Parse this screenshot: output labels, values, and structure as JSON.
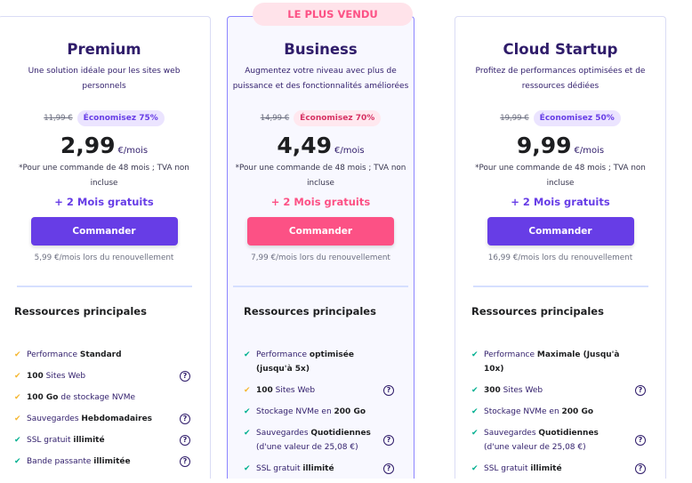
{
  "badge": "LE PLUS VENDU",
  "colors": {
    "purple": "#673de6",
    "pink": "#fc5185",
    "check_green": "#00b090",
    "check_yellow": "#f5b731"
  },
  "plans": [
    {
      "title": "Premium",
      "desc": "Une solution idéale pour les sites web personnels",
      "old_price": "11,99 €",
      "save": "Économisez 75%",
      "price": "2,99",
      "per": "€/mois",
      "note": "*Pour une commande de 48 mois ; TVA non incluse",
      "free": "+ 2 Mois gratuits",
      "button": "Commander",
      "renew": "5,99 €/mois lors du renouvellement",
      "section": "Ressources principales",
      "features": [
        {
          "check": "yellow",
          "help": false,
          "parts": [
            [
              "Performance ",
              0
            ],
            [
              "Standard",
              1
            ]
          ]
        },
        {
          "check": "yellow",
          "help": true,
          "parts": [
            [
              "100",
              1
            ],
            [
              " Sites Web",
              0
            ]
          ]
        },
        {
          "check": "yellow",
          "help": false,
          "parts": [
            [
              "100 Go",
              1
            ],
            [
              " de stockage NVMe",
              0
            ]
          ]
        },
        {
          "check": "yellow",
          "help": true,
          "parts": [
            [
              "Sauvegardes ",
              0
            ],
            [
              "Hebdomadaires",
              1
            ]
          ]
        },
        {
          "check": "green",
          "help": true,
          "parts": [
            [
              "SSL gratuit ",
              0
            ],
            [
              "illimité",
              1
            ]
          ]
        },
        {
          "check": "green",
          "help": true,
          "parts": [
            [
              "Bande passante ",
              0
            ],
            [
              "illimitée",
              1
            ]
          ]
        }
      ]
    },
    {
      "title": "Business",
      "desc": "Augmentez votre niveau avec plus de puissance et des fonctionnalités améliorées",
      "old_price": "14,99 €",
      "save": "Économisez 70%",
      "price": "4,49",
      "per": "€/mois",
      "note": "*Pour une commande de 48 mois ; TVA non incluse",
      "free": "+ 2 Mois gratuits",
      "button": "Commander",
      "renew": "7,99 €/mois lors du renouvellement",
      "section": "Ressources principales",
      "features": [
        {
          "check": "green",
          "help": false,
          "parts": [
            [
              "Performance ",
              0
            ],
            [
              "optimisée (jusqu'à 5x)",
              1
            ]
          ]
        },
        {
          "check": "yellow",
          "help": true,
          "parts": [
            [
              "100",
              1
            ],
            [
              " Sites Web",
              0
            ]
          ]
        },
        {
          "check": "green",
          "help": false,
          "parts": [
            [
              "Stockage NVMe en ",
              0
            ],
            [
              "200 Go",
              1
            ]
          ]
        },
        {
          "check": "green",
          "help": true,
          "parts": [
            [
              "Sauvegardes ",
              0
            ],
            [
              "Quotidiennes",
              1
            ],
            [
              " (d'une valeur de 25,08 €)",
              0
            ]
          ]
        },
        {
          "check": "green",
          "help": true,
          "parts": [
            [
              "SSL gratuit ",
              0
            ],
            [
              "illimité",
              1
            ]
          ]
        }
      ]
    },
    {
      "title": "Cloud Startup",
      "desc": "Profitez de performances optimisées et de ressources dédiées",
      "old_price": "19,99 €",
      "save": "Économisez 50%",
      "price": "9,99",
      "per": "€/mois",
      "note": "*Pour une commande de 48 mois ; TVA non incluse",
      "free": "+ 2 Mois gratuits",
      "button": "Commander",
      "renew": "16,99 €/mois lors du renouvellement",
      "section": "Ressources principales",
      "features": [
        {
          "check": "green",
          "help": false,
          "parts": [
            [
              "Performance ",
              0
            ],
            [
              "Maximale (Jusqu'à 10x)",
              1
            ]
          ]
        },
        {
          "check": "green",
          "help": true,
          "parts": [
            [
              "300",
              1
            ],
            [
              " Sites Web",
              0
            ]
          ]
        },
        {
          "check": "green",
          "help": false,
          "parts": [
            [
              "Stockage NVMe en ",
              0
            ],
            [
              "200 Go",
              1
            ]
          ]
        },
        {
          "check": "green",
          "help": true,
          "parts": [
            [
              "Sauvegardes ",
              0
            ],
            [
              "Quotidiennes",
              1
            ],
            [
              " (d'une valeur de 25,08 €)",
              0
            ]
          ]
        },
        {
          "check": "green",
          "help": true,
          "parts": [
            [
              "SSL gratuit ",
              0
            ],
            [
              "illimité",
              1
            ]
          ]
        }
      ]
    }
  ]
}
